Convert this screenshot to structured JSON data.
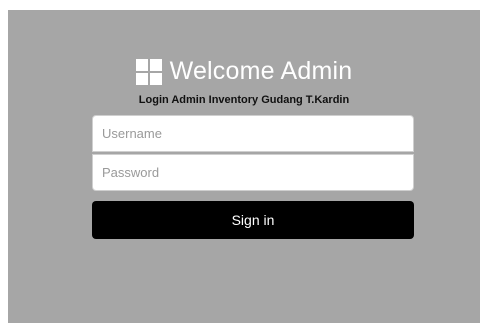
{
  "header": {
    "logo_icon": "windows-grid-icon",
    "title": "Welcome Admin",
    "subtitle": "Login Admin Inventory Gudang T.Kardin"
  },
  "form": {
    "username": {
      "value": "",
      "placeholder": "Username"
    },
    "password": {
      "value": "",
      "placeholder": "Password"
    },
    "submit_label": "Sign in"
  },
  "colors": {
    "panel_background": "#a6a6a6",
    "button_background": "#000000",
    "title_text": "#ffffff"
  }
}
